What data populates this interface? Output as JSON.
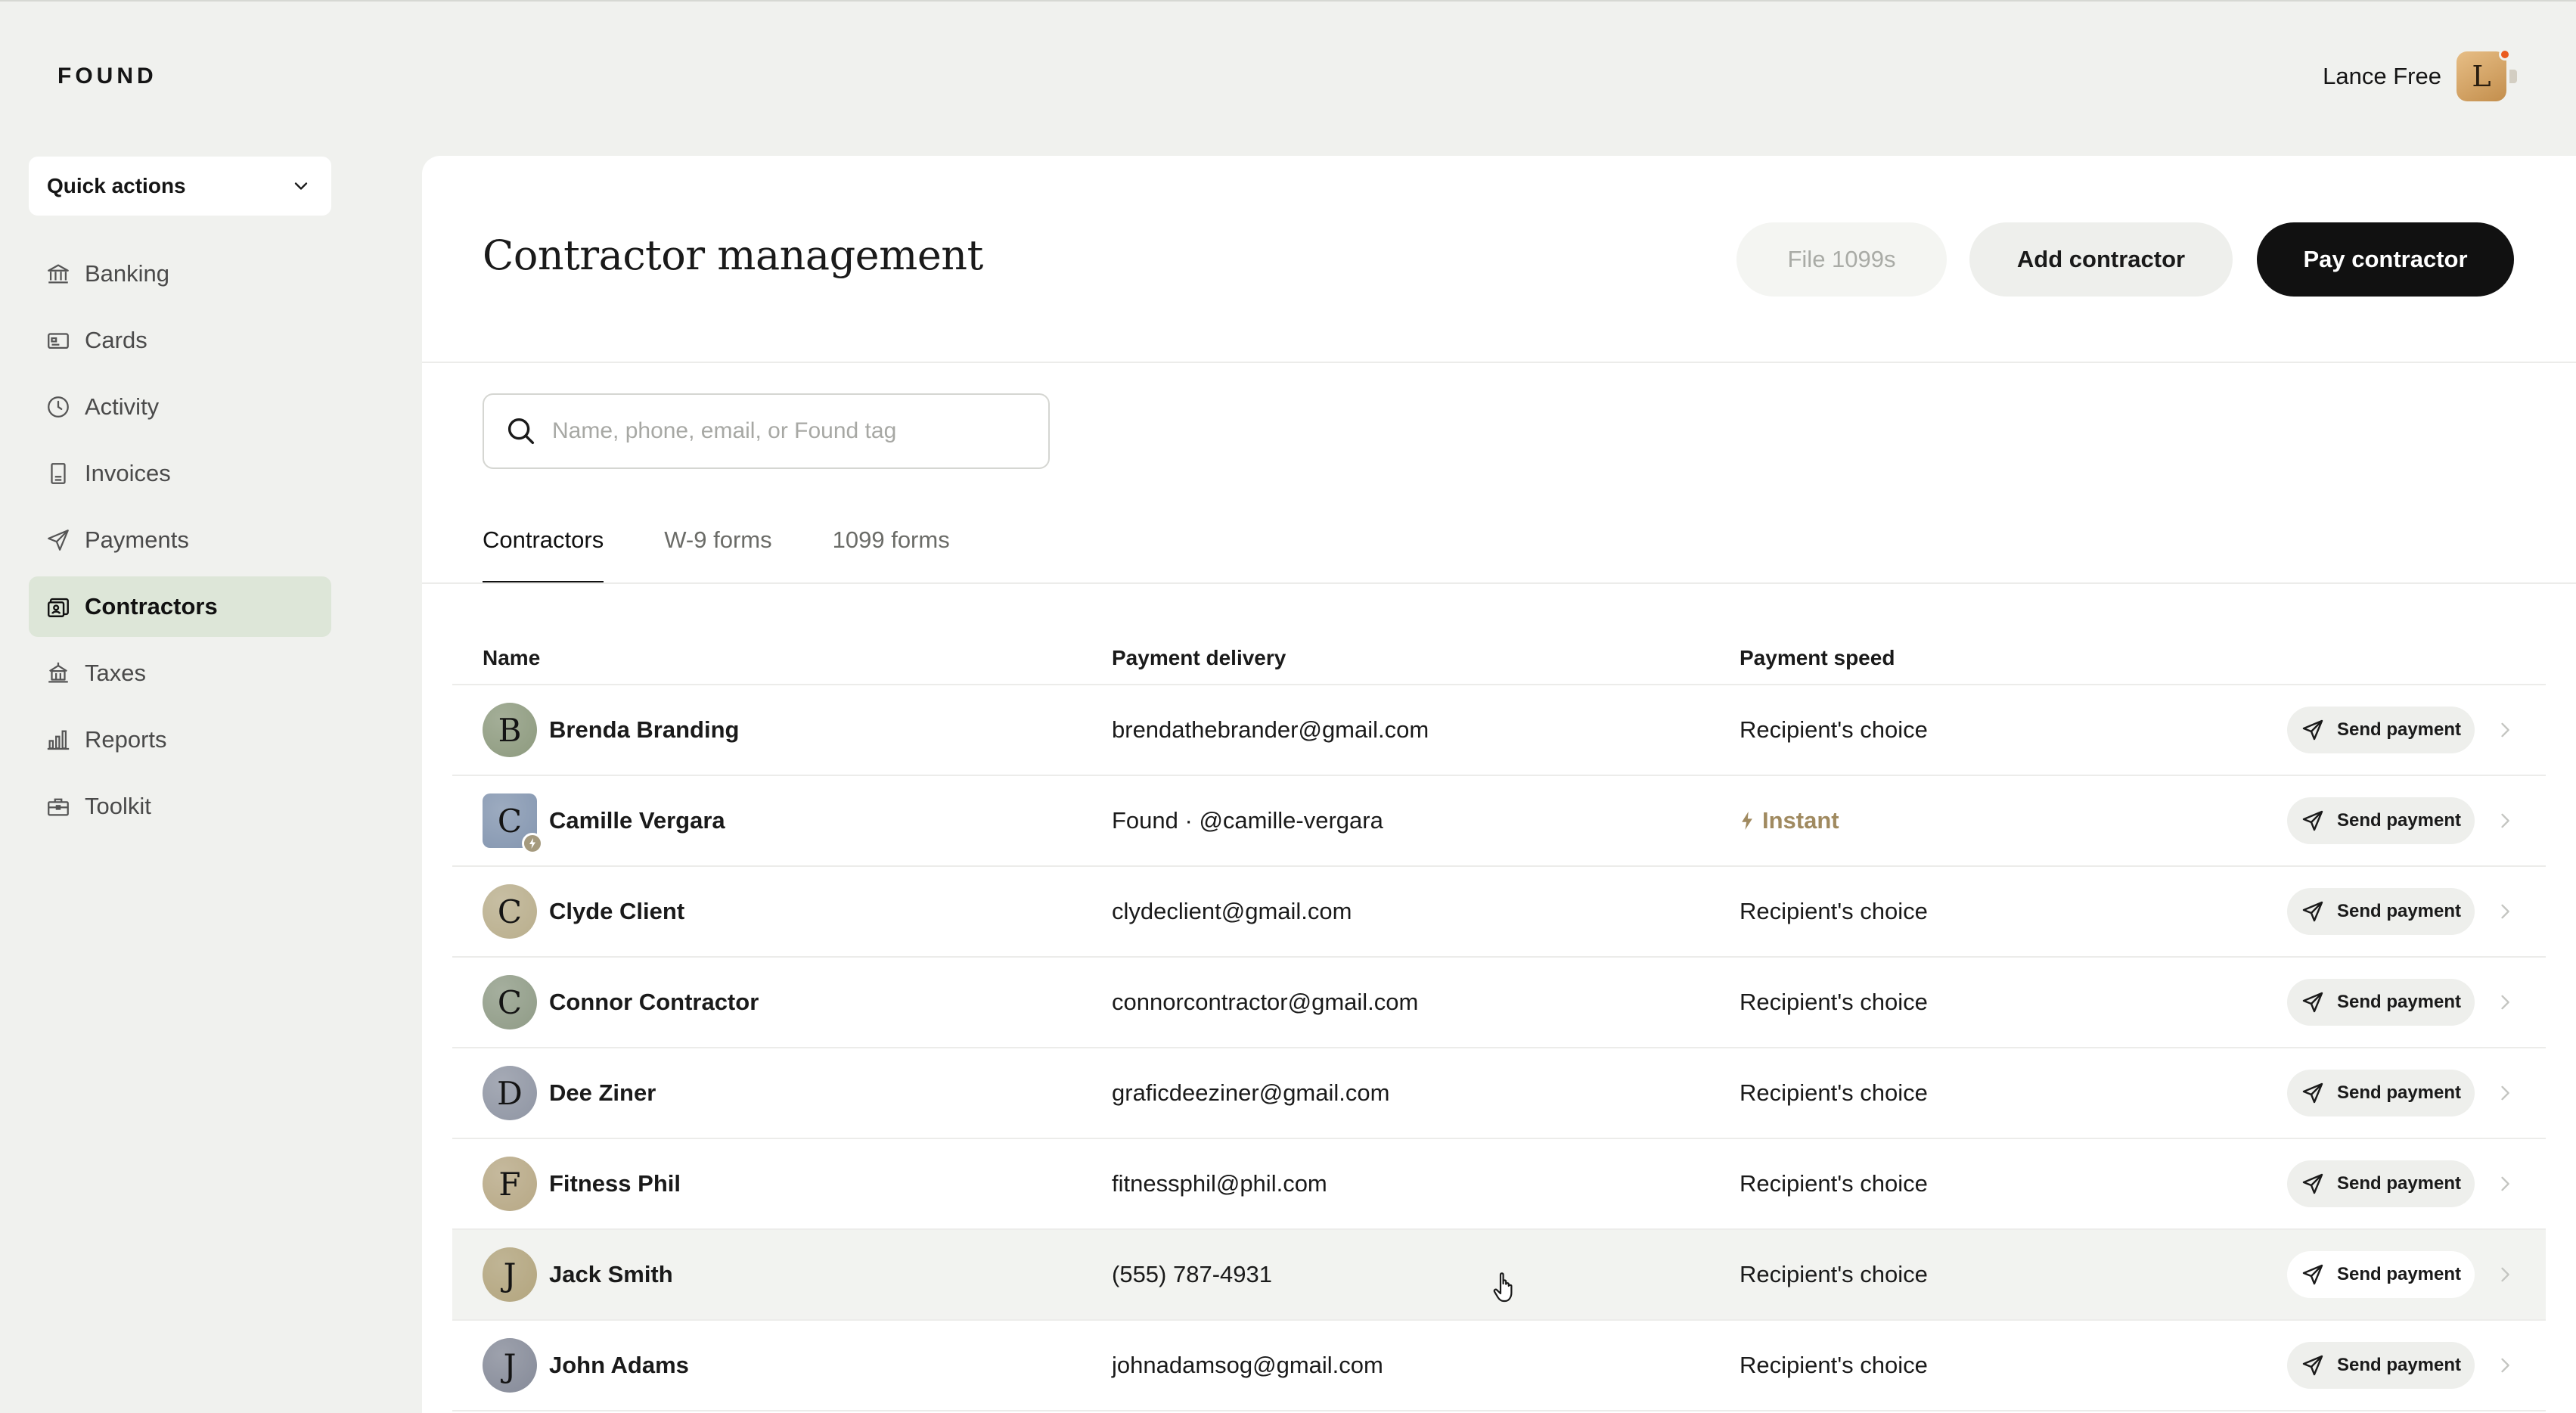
{
  "brand": {
    "logo": "FOUND"
  },
  "user": {
    "name": "Lance Free",
    "initial": "L"
  },
  "sidebar": {
    "quick_actions": "Quick actions",
    "items": [
      {
        "label": "Banking",
        "icon": "bank-icon"
      },
      {
        "label": "Cards",
        "icon": "card-icon"
      },
      {
        "label": "Activity",
        "icon": "clock-icon"
      },
      {
        "label": "Invoices",
        "icon": "invoice-icon"
      },
      {
        "label": "Payments",
        "icon": "send-icon"
      },
      {
        "label": "Contractors",
        "icon": "contractor-icon",
        "active": true
      },
      {
        "label": "Taxes",
        "icon": "taxes-icon"
      },
      {
        "label": "Reports",
        "icon": "bar-chart-icon"
      },
      {
        "label": "Toolkit",
        "icon": "toolbox-icon"
      }
    ]
  },
  "main": {
    "title": "Contractor management",
    "buttons": {
      "file": "File 1099s",
      "add": "Add contractor",
      "pay": "Pay contractor"
    },
    "search": {
      "placeholder": "Name, phone, email, or Found tag",
      "value": ""
    },
    "tabs": [
      {
        "label": "Contractors",
        "active": true
      },
      {
        "label": "W-9 forms"
      },
      {
        "label": "1099 forms"
      }
    ],
    "table": {
      "columns": {
        "name": "Name",
        "delivery": "Payment delivery",
        "speed": "Payment speed"
      },
      "send_label": "Send payment",
      "rows": [
        {
          "initial": "B",
          "name": "Brenda Branding",
          "delivery": "brendathebrander@gmail.com",
          "speed": "Recipient's choice",
          "avatar_color": "#8d9a7e"
        },
        {
          "initial": "C",
          "name": "Camille Vergara",
          "delivery": "Found · @camille-vergara",
          "speed": "Instant",
          "instant": true,
          "avatar_color": "#8496b0"
        },
        {
          "initial": "C",
          "name": "Clyde Client",
          "delivery": "clydeclient@gmail.com",
          "speed": "Recipient's choice",
          "avatar_color": "#b9ae8c"
        },
        {
          "initial": "C",
          "name": "Connor Contractor",
          "delivery": "connorcontractor@gmail.com",
          "speed": "Recipient's choice",
          "avatar_color": "#8f9b86"
        },
        {
          "initial": "D",
          "name": "Dee Ziner",
          "delivery": "graficdeeziner@gmail.com",
          "speed": "Recipient's choice",
          "avatar_color": "#8f95a3"
        },
        {
          "initial": "F",
          "name": "Fitness Phil",
          "delivery": "fitnessphil@phil.com",
          "speed": "Recipient's choice",
          "avatar_color": "#b7a885"
        },
        {
          "initial": "J",
          "name": "Jack Smith",
          "delivery": "(555) 787-4931",
          "speed": "Recipient's choice",
          "avatar_color": "#b3a57e",
          "hovered": true
        },
        {
          "initial": "J",
          "name": "John Adams",
          "delivery": "johnadamsog@gmail.com",
          "speed": "Recipient's choice",
          "avatar_color": "#858a98"
        }
      ]
    }
  }
}
